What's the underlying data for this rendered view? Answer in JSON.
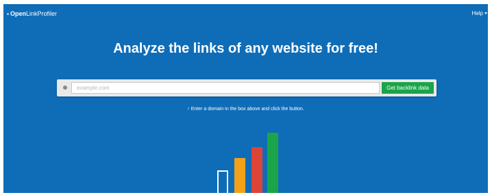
{
  "nav": {
    "logo_bold": "Open",
    "logo_rest": "LinkProfiler",
    "help_label": "Help"
  },
  "hero": {
    "headline": "Analyze the links of any website for free!"
  },
  "search": {
    "placeholder": "example.com",
    "value": "",
    "button_label": "Get backlink data"
  },
  "hint": {
    "arrow": "↑",
    "text": "Enter a domain in the box above and click the button."
  },
  "decorative_bars": [
    {
      "color": "#0f6db8",
      "outline": "#ffffff",
      "level": 0.35
    },
    {
      "color": "#f4a11a",
      "outline": null,
      "level": 0.54
    },
    {
      "color": "#db4437",
      "outline": null,
      "level": 0.71
    },
    {
      "color": "#1aa54a",
      "outline": null,
      "level": 0.93
    }
  ],
  "colors": {
    "background": "#0f6db8",
    "button": "#1aa54a"
  }
}
